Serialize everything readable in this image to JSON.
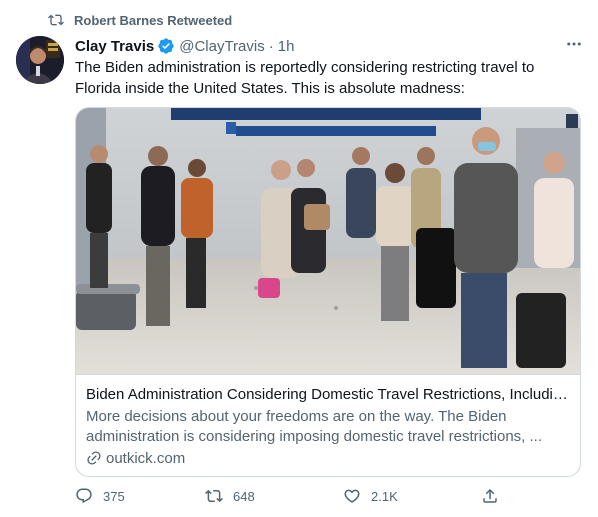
{
  "retweet": {
    "label": "Robert Barnes Retweeted",
    "icon": "retweet-icon"
  },
  "author": {
    "display_name": "Clay Travis",
    "verified": true,
    "handle": "@ClayTravis",
    "separator": "·",
    "time": "1h",
    "avatar_icon": "avatar-photo"
  },
  "tweet": {
    "text": "The Biden administration is reportedly considering restricting travel to Florida inside the United States. This is absolute madness:"
  },
  "card": {
    "image_icon": "airport-photo",
    "title": "Biden Administration Considering Domestic Travel Restrictions, Includin...",
    "description": "More decisions about your freedoms are on the way.  The Biden administration is considering imposing domestic travel restrictions, ...",
    "domain": "outkick.com",
    "link_icon": "link-icon"
  },
  "actions": {
    "reply": {
      "count": "375",
      "icon": "reply-icon"
    },
    "retweet": {
      "count": "648",
      "icon": "retweet-icon"
    },
    "like": {
      "count": "2.1K",
      "icon": "heart-icon"
    },
    "share": {
      "icon": "share-icon"
    }
  },
  "colors": {
    "primary_text": "#0f1419",
    "secondary_text": "#536471",
    "verified_blue": "#1d9bf0",
    "border": "#cfd9de"
  }
}
